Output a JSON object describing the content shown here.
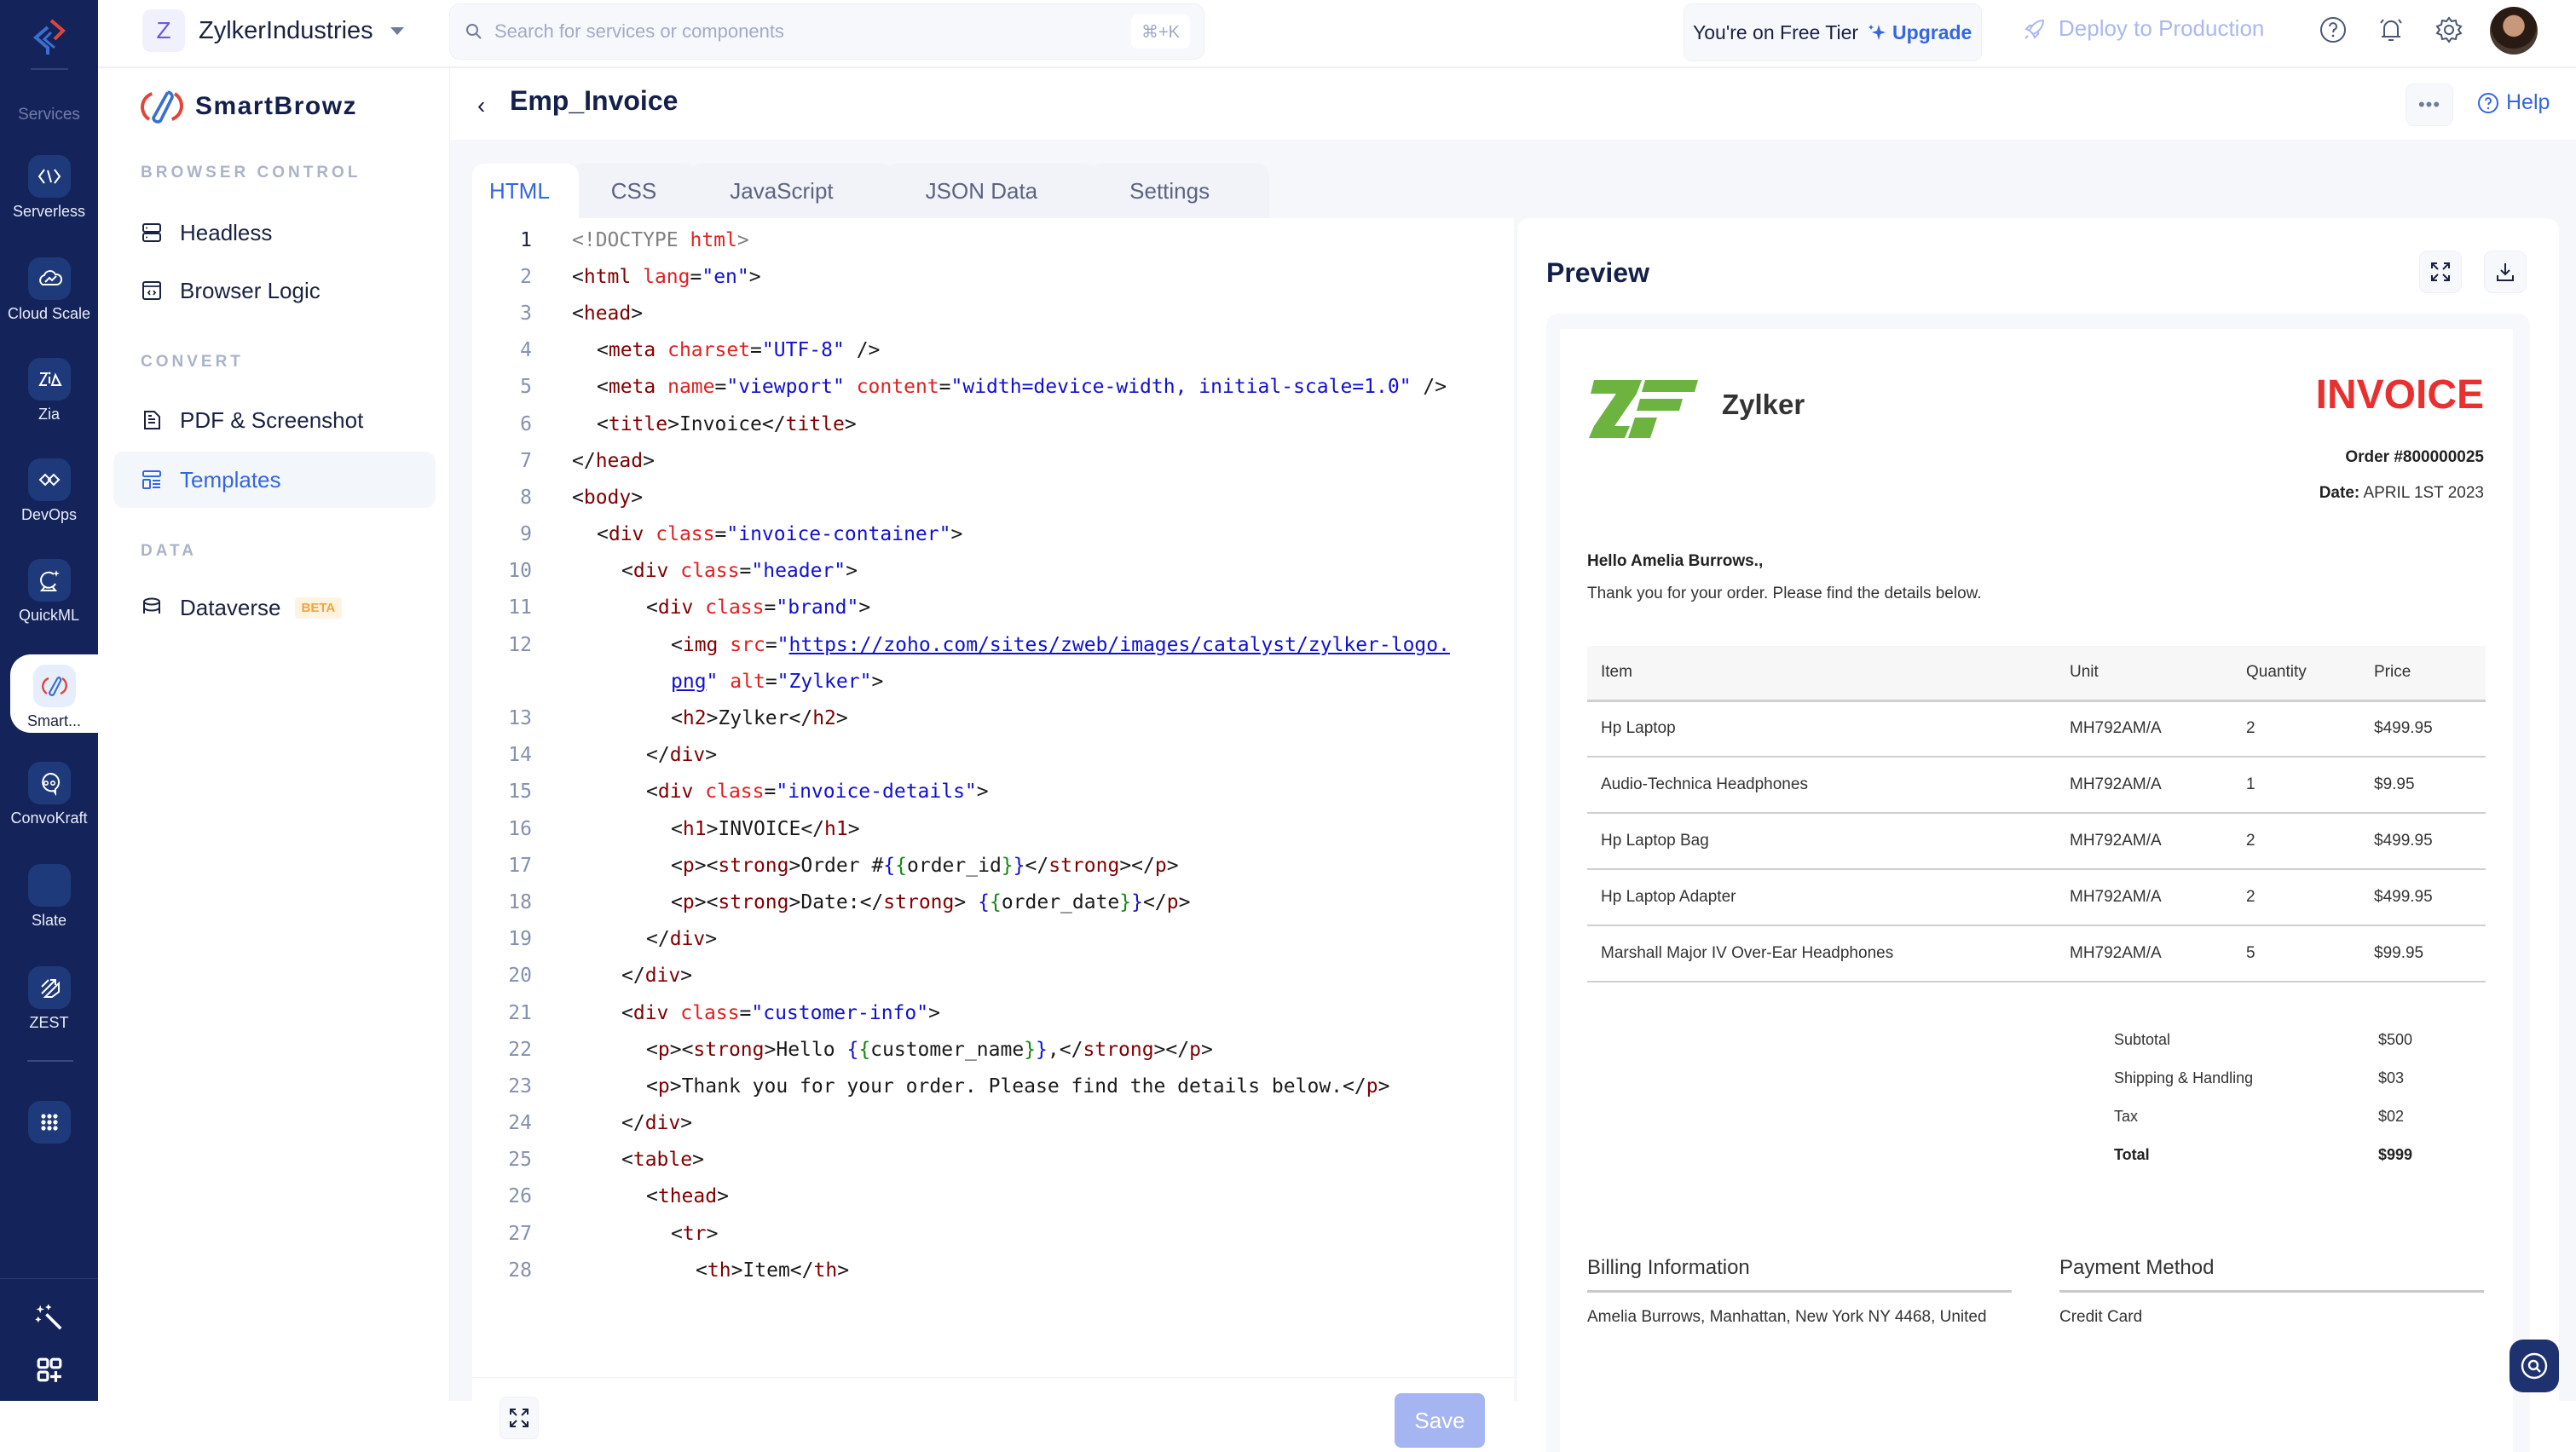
{
  "rail": {
    "services_label": "Services",
    "items": [
      {
        "label": "Serverless",
        "icon": "serverless-icon"
      },
      {
        "label": "Cloud Scale",
        "icon": "cloud-scale-icon"
      },
      {
        "label": "Zia",
        "icon": "zia-icon"
      },
      {
        "label": "DevOps",
        "icon": "devops-icon"
      },
      {
        "label": "QuickML",
        "icon": "quickml-icon"
      },
      {
        "label": "Smart...",
        "icon": "smartbrowz-icon",
        "active": true
      },
      {
        "label": "ConvoKraft",
        "icon": "convokraft-icon"
      },
      {
        "label": "Slate",
        "icon": "slate-icon"
      },
      {
        "label": "ZEST",
        "icon": "zest-icon"
      }
    ]
  },
  "topbar": {
    "org_initial": "Z",
    "org_name": "ZylkerIndustries",
    "search_placeholder": "Search for services or components",
    "search_shortcut": "⌘+K",
    "tier_text": "You're on Free Tier",
    "upgrade_label": "Upgrade",
    "deploy_label": "Deploy to Production"
  },
  "sidebar": {
    "brand": "SmartBrowz",
    "sections": [
      {
        "title": "BROWSER CONTROL",
        "items": [
          {
            "label": "Headless"
          },
          {
            "label": "Browser Logic"
          }
        ]
      },
      {
        "title": "CONVERT",
        "items": [
          {
            "label": "PDF & Screenshot"
          },
          {
            "label": "Templates",
            "active": true
          }
        ]
      },
      {
        "title": "DATA",
        "items": [
          {
            "label": "Dataverse",
            "badge": "BETA"
          }
        ]
      }
    ]
  },
  "page": {
    "title": "Emp_Invoice",
    "help_label": "Help",
    "more_label": "•••"
  },
  "tabs": [
    {
      "label": "HTML",
      "active": true
    },
    {
      "label": "CSS"
    },
    {
      "label": "JavaScript"
    },
    {
      "label": "JSON Data"
    },
    {
      "label": "Settings"
    }
  ],
  "editor": {
    "save_label": "Save",
    "active_line": 1,
    "lines": [
      {
        "n": "1",
        "ind": 0,
        "seg": [
          [
            "gray",
            "<!DOCTYPE "
          ],
          [
            "attr",
            "html"
          ],
          [
            "gray",
            ">"
          ]
        ]
      },
      {
        "n": "2",
        "ind": 0,
        "seg": [
          [
            "p",
            "<"
          ],
          [
            "tag",
            "html"
          ],
          [
            "p",
            " "
          ],
          [
            "attr",
            "lang"
          ],
          [
            "p",
            "="
          ],
          [
            "val",
            "\"en\""
          ],
          [
            "p",
            ">"
          ]
        ]
      },
      {
        "n": "3",
        "ind": 0,
        "seg": [
          [
            "p",
            "<"
          ],
          [
            "tag",
            "head"
          ],
          [
            "p",
            ">"
          ]
        ]
      },
      {
        "n": "4",
        "ind": 1,
        "seg": [
          [
            "p",
            "<"
          ],
          [
            "tag",
            "meta"
          ],
          [
            "p",
            " "
          ],
          [
            "attr",
            "charset"
          ],
          [
            "p",
            "="
          ],
          [
            "val",
            "\"UTF-8\""
          ],
          [
            "p",
            " />"
          ]
        ]
      },
      {
        "n": "5",
        "ind": 1,
        "seg": [
          [
            "p",
            "<"
          ],
          [
            "tag",
            "meta"
          ],
          [
            "p",
            " "
          ],
          [
            "attr",
            "name"
          ],
          [
            "p",
            "="
          ],
          [
            "val",
            "\"viewport\""
          ],
          [
            "p",
            " "
          ],
          [
            "attr",
            "content"
          ],
          [
            "p",
            "="
          ],
          [
            "val",
            "\"width=device-width, initial-scale=1.0\""
          ],
          [
            "p",
            " />"
          ]
        ]
      },
      {
        "n": "6",
        "ind": 1,
        "seg": [
          [
            "p",
            "<"
          ],
          [
            "tag",
            "title"
          ],
          [
            "p",
            ">Invoice</"
          ],
          [
            "tag",
            "title"
          ],
          [
            "p",
            ">"
          ]
        ]
      },
      {
        "n": "7",
        "ind": 0,
        "seg": [
          [
            "p",
            "</"
          ],
          [
            "tag",
            "head"
          ],
          [
            "p",
            ">"
          ]
        ]
      },
      {
        "n": "8",
        "ind": 0,
        "seg": [
          [
            "p",
            "<"
          ],
          [
            "tag",
            "body"
          ],
          [
            "p",
            ">"
          ]
        ]
      },
      {
        "n": "9",
        "ind": 1,
        "seg": [
          [
            "p",
            "<"
          ],
          [
            "tag",
            "div"
          ],
          [
            "p",
            " "
          ],
          [
            "attr",
            "class"
          ],
          [
            "p",
            "="
          ],
          [
            "val",
            "\"invoice-container\""
          ],
          [
            "p",
            ">"
          ]
        ]
      },
      {
        "n": "10",
        "ind": 2,
        "seg": [
          [
            "p",
            "<"
          ],
          [
            "tag",
            "div"
          ],
          [
            "p",
            " "
          ],
          [
            "attr",
            "class"
          ],
          [
            "p",
            "="
          ],
          [
            "val",
            "\"header\""
          ],
          [
            "p",
            ">"
          ]
        ]
      },
      {
        "n": "11",
        "ind": 3,
        "seg": [
          [
            "p",
            "<"
          ],
          [
            "tag",
            "div"
          ],
          [
            "p",
            " "
          ],
          [
            "attr",
            "class"
          ],
          [
            "p",
            "="
          ],
          [
            "val",
            "\"brand\""
          ],
          [
            "p",
            ">"
          ]
        ]
      },
      {
        "n": "12",
        "ind": 4,
        "seg": [
          [
            "p",
            "<"
          ],
          [
            "tag",
            "img"
          ],
          [
            "p",
            " "
          ],
          [
            "attr",
            "src"
          ],
          [
            "p",
            "="
          ],
          [
            "val",
            "\""
          ],
          [
            "link",
            "https://zoho.com/sites/zweb/images/catalyst/zylker-logo."
          ]
        ]
      },
      {
        "n": "",
        "ind": 4,
        "seg": [
          [
            "link",
            "png"
          ],
          [
            "val",
            "\""
          ],
          [
            "p",
            " "
          ],
          [
            "attr",
            "alt"
          ],
          [
            "p",
            "="
          ],
          [
            "val",
            "\"Zylker\""
          ],
          [
            "p",
            ">"
          ]
        ]
      },
      {
        "n": "13",
        "ind": 4,
        "seg": [
          [
            "p",
            "<"
          ],
          [
            "tag",
            "h2"
          ],
          [
            "p",
            ">Zylker</"
          ],
          [
            "tag",
            "h2"
          ],
          [
            "p",
            ">"
          ]
        ]
      },
      {
        "n": "14",
        "ind": 3,
        "seg": [
          [
            "p",
            "</"
          ],
          [
            "tag",
            "div"
          ],
          [
            "p",
            ">"
          ]
        ]
      },
      {
        "n": "15",
        "ind": 3,
        "seg": [
          [
            "p",
            "<"
          ],
          [
            "tag",
            "div"
          ],
          [
            "p",
            " "
          ],
          [
            "attr",
            "class"
          ],
          [
            "p",
            "="
          ],
          [
            "val",
            "\"invoice-details\""
          ],
          [
            "p",
            ">"
          ]
        ]
      },
      {
        "n": "16",
        "ind": 4,
        "seg": [
          [
            "p",
            "<"
          ],
          [
            "tag",
            "h1"
          ],
          [
            "p",
            ">INVOICE</"
          ],
          [
            "tag",
            "h1"
          ],
          [
            "p",
            ">"
          ]
        ]
      },
      {
        "n": "17",
        "ind": 4,
        "seg": [
          [
            "p",
            "<"
          ],
          [
            "tag",
            "p"
          ],
          [
            "p",
            "><"
          ],
          [
            "tag",
            "strong"
          ],
          [
            "p",
            ">Order #"
          ],
          [
            "br1",
            "{"
          ],
          [
            "br2",
            "{"
          ],
          [
            "p",
            "order_id"
          ],
          [
            "br2",
            "}"
          ],
          [
            "br1",
            "}"
          ],
          [
            "p",
            "</"
          ],
          [
            "tag",
            "strong"
          ],
          [
            "p",
            "></"
          ],
          [
            "tag",
            "p"
          ],
          [
            "p",
            ">"
          ]
        ]
      },
      {
        "n": "18",
        "ind": 4,
        "seg": [
          [
            "p",
            "<"
          ],
          [
            "tag",
            "p"
          ],
          [
            "p",
            "><"
          ],
          [
            "tag",
            "strong"
          ],
          [
            "p",
            ">Date:</"
          ],
          [
            "tag",
            "strong"
          ],
          [
            "p",
            "> "
          ],
          [
            "br1",
            "{"
          ],
          [
            "br2",
            "{"
          ],
          [
            "p",
            "order_date"
          ],
          [
            "br2",
            "}"
          ],
          [
            "br1",
            "}"
          ],
          [
            "p",
            "</"
          ],
          [
            "tag",
            "p"
          ],
          [
            "p",
            ">"
          ]
        ]
      },
      {
        "n": "19",
        "ind": 3,
        "seg": [
          [
            "p",
            "</"
          ],
          [
            "tag",
            "div"
          ],
          [
            "p",
            ">"
          ]
        ]
      },
      {
        "n": "20",
        "ind": 2,
        "seg": [
          [
            "p",
            "</"
          ],
          [
            "tag",
            "div"
          ],
          [
            "p",
            ">"
          ]
        ]
      },
      {
        "n": "21",
        "ind": 2,
        "seg": [
          [
            "p",
            "<"
          ],
          [
            "tag",
            "div"
          ],
          [
            "p",
            " "
          ],
          [
            "attr",
            "class"
          ],
          [
            "p",
            "="
          ],
          [
            "val",
            "\"customer-info\""
          ],
          [
            "p",
            ">"
          ]
        ]
      },
      {
        "n": "22",
        "ind": 3,
        "seg": [
          [
            "p",
            "<"
          ],
          [
            "tag",
            "p"
          ],
          [
            "p",
            "><"
          ],
          [
            "tag",
            "strong"
          ],
          [
            "p",
            ">Hello "
          ],
          [
            "br1",
            "{"
          ],
          [
            "br2",
            "{"
          ],
          [
            "p",
            "customer_name"
          ],
          [
            "br2",
            "}"
          ],
          [
            "br1",
            "}"
          ],
          [
            "p",
            ",</"
          ],
          [
            "tag",
            "strong"
          ],
          [
            "p",
            "></"
          ],
          [
            "tag",
            "p"
          ],
          [
            "p",
            ">"
          ]
        ]
      },
      {
        "n": "23",
        "ind": 3,
        "seg": [
          [
            "p",
            "<"
          ],
          [
            "tag",
            "p"
          ],
          [
            "p",
            ">Thank you for your order. Please find the details below.</"
          ],
          [
            "tag",
            "p"
          ],
          [
            "p",
            ">"
          ]
        ]
      },
      {
        "n": "24",
        "ind": 2,
        "seg": [
          [
            "p",
            "</"
          ],
          [
            "tag",
            "div"
          ],
          [
            "p",
            ">"
          ]
        ]
      },
      {
        "n": "25",
        "ind": 2,
        "seg": [
          [
            "p",
            "<"
          ],
          [
            "tag",
            "table"
          ],
          [
            "p",
            ">"
          ]
        ]
      },
      {
        "n": "26",
        "ind": 3,
        "seg": [
          [
            "p",
            "<"
          ],
          [
            "tag",
            "thead"
          ],
          [
            "p",
            ">"
          ]
        ]
      },
      {
        "n": "27",
        "ind": 4,
        "seg": [
          [
            "p",
            "<"
          ],
          [
            "tag",
            "tr"
          ],
          [
            "p",
            ">"
          ]
        ]
      },
      {
        "n": "28",
        "ind": 5,
        "seg": [
          [
            "p",
            "<"
          ],
          [
            "tag",
            "th"
          ],
          [
            "p",
            ">Item</"
          ],
          [
            "tag",
            "th"
          ],
          [
            "p",
            ">"
          ]
        ]
      }
    ]
  },
  "preview": {
    "title": "Preview",
    "invoice": {
      "brand_name": "Zylker",
      "heading": "INVOICE",
      "order": "Order #800000025",
      "date_label": "Date:",
      "date_value": "APRIL 1ST 2023",
      "greeting": "Hello Amelia Burrows.,",
      "message": "Thank you for your order. Please find the details below.",
      "columns": [
        "Item",
        "Unit",
        "Quantity",
        "Price"
      ],
      "rows": [
        [
          "Hp Laptop",
          "MH792AM/A",
          "2",
          "$499.95"
        ],
        [
          "Audio-Technica Headphones",
          "MH792AM/A",
          "1",
          "$9.95"
        ],
        [
          "Hp Laptop Bag",
          "MH792AM/A",
          "2",
          "$499.95"
        ],
        [
          "Hp Laptop Adapter",
          "MH792AM/A",
          "2",
          "$499.95"
        ],
        [
          "Marshall Major IV Over-Ear Headphones",
          "MH792AM/A",
          "5",
          "$99.95"
        ]
      ],
      "totals": [
        {
          "label": "Subtotal",
          "value": "$500"
        },
        {
          "label": "Shipping & Handling",
          "value": "$03"
        },
        {
          "label": "Tax",
          "value": "$02"
        },
        {
          "label": "Total",
          "value": "$999",
          "bold": true
        }
      ],
      "billing_title": "Billing Information",
      "billing_value": "Amelia Burrows, Manhattan, New York NY 4468, United",
      "payment_title": "Payment Method",
      "payment_value": "Credit Card"
    }
  },
  "colors": {
    "rail_bg": "#14245a",
    "accent": "#3566e0",
    "invoice_red": "#e8302f",
    "zylker_green": "#6cb33f",
    "beta_orange": "#f2a43c"
  }
}
